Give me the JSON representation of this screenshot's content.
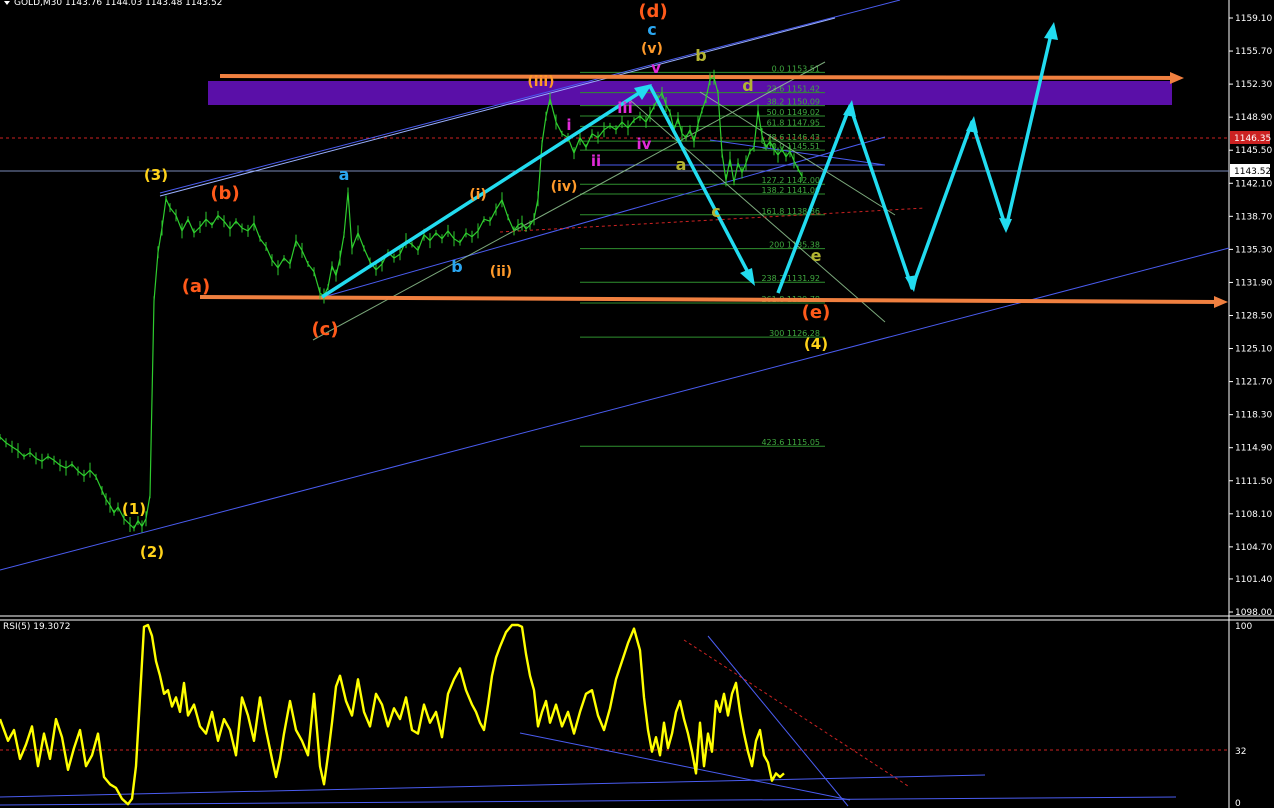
{
  "window": {
    "symbol_header": "GOLD,M30  1143.76 1144.03 1143.48 1143.52",
    "rsi_header": "RSI(5) 19.3072"
  },
  "price_axis": {
    "min": 1096.5,
    "max": 1161.5,
    "ticks": [
      "1159.10",
      "1155.70",
      "1152.30",
      "1148.90",
      "1145.50",
      "1142.10",
      "1138.70",
      "1135.30",
      "1131.90",
      "1128.50",
      "1125.10",
      "1121.70",
      "1118.30",
      "1114.90",
      "1111.50",
      "1108.10",
      "1104.70",
      "1101.40",
      "1098.00"
    ],
    "current_price": "1143.52",
    "marker_price": "1146.35",
    "current_price_color": "#ffffff",
    "marker_price_color": "#cc2222"
  },
  "rsi_axis": {
    "ticks": [
      "100",
      "32",
      "0"
    ]
  },
  "chart_data": [
    {
      "type": "line",
      "name": "price",
      "series_color": "#2ecc2e",
      "y_unit": "price",
      "x": [
        0,
        6,
        12,
        18,
        24,
        30,
        36,
        42,
        48,
        54,
        60,
        66,
        72,
        78,
        84,
        90,
        96,
        102,
        106,
        110,
        114,
        118,
        124,
        130,
        134,
        138,
        142,
        146,
        150,
        154,
        158,
        162,
        166,
        170,
        176,
        182,
        188,
        194,
        200,
        206,
        212,
        218,
        224,
        230,
        236,
        242,
        248,
        254,
        260,
        266,
        272,
        278,
        284,
        290,
        296,
        302,
        308,
        314,
        320,
        324,
        328,
        332,
        336,
        340,
        344,
        348,
        352,
        358,
        364,
        370,
        376,
        382,
        388,
        394,
        400,
        406,
        412,
        418,
        424,
        430,
        436,
        442,
        448,
        454,
        460,
        466,
        472,
        478,
        484,
        490,
        496,
        502,
        508,
        514,
        518,
        522,
        526,
        530,
        534,
        538,
        542,
        546,
        550,
        556,
        562,
        568,
        574,
        580,
        586,
        592,
        598,
        604,
        610,
        616,
        622,
        628,
        634,
        640,
        646,
        650,
        654,
        658,
        662,
        666,
        670,
        674,
        678,
        682,
        686,
        690,
        694,
        698,
        702,
        706,
        710,
        714,
        718,
        722,
        726,
        730,
        734,
        738,
        742,
        746,
        750,
        754,
        758,
        762,
        766,
        770,
        774,
        778,
        782,
        786,
        790,
        794,
        798,
        802
      ],
      "y": [
        1116.0,
        1115.4,
        1115.0,
        1114.6,
        1114.0,
        1114.4,
        1113.8,
        1113.5,
        1114.0,
        1113.6,
        1113.1,
        1112.8,
        1113.2,
        1112.5,
        1112.0,
        1112.6,
        1111.9,
        1110.5,
        1109.6,
        1109.0,
        1108.2,
        1108.8,
        1107.6,
        1107.0,
        1106.6,
        1107.4,
        1106.8,
        1107.6,
        1110.0,
        1130.0,
        1135.0,
        1137.5,
        1140.5,
        1139.6,
        1138.8,
        1137.2,
        1138.4,
        1137.0,
        1137.6,
        1138.4,
        1137.8,
        1138.8,
        1138.2,
        1137.4,
        1138.2,
        1137.5,
        1137.2,
        1138.0,
        1136.4,
        1135.6,
        1134.2,
        1133.4,
        1134.4,
        1133.8,
        1136.2,
        1135.2,
        1133.8,
        1133.0,
        1130.8,
        1130.5,
        1131.4,
        1133.6,
        1132.6,
        1134.4,
        1136.8,
        1141.2,
        1135.4,
        1137.0,
        1135.4,
        1134.0,
        1133.2,
        1133.8,
        1135.0,
        1134.4,
        1134.8,
        1136.2,
        1135.8,
        1135.2,
        1136.8,
        1136.2,
        1137.0,
        1136.4,
        1137.2,
        1136.4,
        1136.0,
        1137.0,
        1136.6,
        1137.2,
        1138.4,
        1138.2,
        1139.4,
        1140.4,
        1138.6,
        1137.2,
        1137.8,
        1138.0,
        1137.4,
        1137.8,
        1138.4,
        1140.5,
        1146.2,
        1149.0,
        1150.8,
        1148.4,
        1147.2,
        1146.8,
        1145.2,
        1146.8,
        1145.8,
        1147.2,
        1146.8,
        1147.6,
        1148.0,
        1147.6,
        1148.4,
        1147.8,
        1148.6,
        1149.0,
        1148.4,
        1149.2,
        1150.0,
        1150.8,
        1151.4,
        1150.2,
        1149.4,
        1147.6,
        1148.8,
        1147.2,
        1146.8,
        1147.6,
        1146.4,
        1148.2,
        1149.6,
        1150.8,
        1152.8,
        1153.0,
        1151.4,
        1145.2,
        1142.4,
        1144.6,
        1142.2,
        1144.2,
        1143.2,
        1144.2,
        1145.4,
        1145.8,
        1149.6,
        1147.0,
        1145.8,
        1146.4,
        1145.6,
        1145.0,
        1145.6,
        1144.8,
        1145.4,
        1144.4,
        1143.6,
        1142.8,
        1143.5
      ]
    },
    {
      "type": "line",
      "name": "RSI(5)",
      "series_color": "#ffff00",
      "y_unit": "rsi",
      "ylim": [
        0,
        100
      ],
      "levels": [
        32
      ],
      "x": [
        0,
        8,
        14,
        20,
        26,
        32,
        38,
        44,
        50,
        56,
        62,
        68,
        74,
        80,
        86,
        92,
        98,
        104,
        110,
        116,
        122,
        128,
        132,
        136,
        140,
        144,
        148,
        152,
        156,
        160,
        164,
        168,
        172,
        176,
        180,
        184,
        188,
        194,
        200,
        206,
        212,
        218,
        224,
        230,
        236,
        242,
        248,
        254,
        260,
        266,
        272,
        276,
        280,
        284,
        290,
        296,
        302,
        308,
        314,
        320,
        324,
        328,
        332,
        336,
        340,
        346,
        352,
        358,
        364,
        370,
        376,
        382,
        388,
        394,
        400,
        406,
        412,
        418,
        424,
        430,
        436,
        442,
        448,
        454,
        460,
        466,
        472,
        476,
        480,
        484,
        488,
        492,
        496,
        500,
        506,
        512,
        518,
        522,
        526,
        530,
        534,
        538,
        542,
        546,
        550,
        556,
        562,
        568,
        574,
        580,
        586,
        592,
        598,
        604,
        610,
        616,
        622,
        628,
        634,
        640,
        644,
        648,
        652,
        656,
        660,
        664,
        668,
        672,
        676,
        680,
        684,
        688,
        692,
        696,
        700,
        704,
        708,
        712,
        716,
        720,
        724,
        728,
        732,
        736,
        740,
        744,
        748,
        752,
        756,
        760,
        764,
        768,
        772,
        776,
        780,
        784,
        788,
        792,
        796,
        800,
        804
      ],
      "y": [
        48,
        36,
        42,
        26,
        34,
        44,
        22,
        40,
        26,
        48,
        38,
        20,
        32,
        42,
        22,
        28,
        40,
        16,
        12,
        10,
        4,
        1,
        4,
        22,
        60,
        99,
        100,
        94,
        80,
        72,
        62,
        64,
        55,
        60,
        52,
        68,
        50,
        56,
        44,
        40,
        52,
        36,
        48,
        42,
        28,
        60,
        50,
        36,
        60,
        42,
        26,
        16,
        26,
        40,
        58,
        42,
        36,
        28,
        62,
        22,
        12,
        28,
        46,
        66,
        72,
        58,
        50,
        70,
        52,
        44,
        62,
        56,
        44,
        54,
        48,
        60,
        42,
        40,
        56,
        46,
        52,
        38,
        62,
        70,
        76,
        64,
        56,
        52,
        46,
        42,
        56,
        72,
        82,
        88,
        96,
        100,
        100,
        99,
        84,
        72,
        64,
        44,
        52,
        58,
        46,
        56,
        44,
        52,
        40,
        52,
        62,
        64,
        50,
        42,
        54,
        70,
        80,
        90,
        98,
        86,
        60,
        42,
        30,
        38,
        28,
        46,
        32,
        40,
        52,
        58,
        48,
        40,
        30,
        18,
        46,
        22,
        40,
        30,
        58,
        52,
        62,
        50,
        62,
        68,
        52,
        40,
        30,
        22,
        36,
        42,
        28,
        24,
        14,
        18,
        16,
        18
      ]
    }
  ],
  "fibo": [
    {
      "label": "0.0 1153.51"
    },
    {
      "label": "23.6 1151.42"
    },
    {
      "label": "38.2 1150.09"
    },
    {
      "label": "50.0 1149.02"
    },
    {
      "label": "61.8 1147.95"
    },
    {
      "label": "78.6 1146.43"
    },
    {
      "label": "100.0 1145.51"
    },
    {
      "label": "127.2 1142.00"
    },
    {
      "label": "138.2 1141.00"
    },
    {
      "label": "161.8 1138.86"
    },
    {
      "label": "200 1135.38"
    },
    {
      "label": "238.2 1131.92"
    },
    {
      "label": "261.8 1129.78"
    },
    {
      "label": "300 1126.28"
    },
    {
      "label": "423.6 1115.05"
    }
  ],
  "wave_labels": {
    "w1": "(1)",
    "w2": "(2)",
    "w3": "(3)",
    "w4": "(4)",
    "wa_big": "(a)",
    "wb_big": "(b)",
    "wc_big": "(c)",
    "wd_big": "(d)",
    "we_big": "(e)",
    "a1": "a",
    "b1": "b",
    "c1": "c",
    "a2": "a",
    "b2": "b",
    "c2": "c",
    "d2": "d",
    "e2": "e",
    "ri": "(i)",
    "rii": "(ii)",
    "riii": "(iii)",
    "riv": "(iv)",
    "rv": "(v)",
    "si": "i",
    "sii": "ii",
    "siii": "iii",
    "siv": "iv",
    "sv": "v"
  },
  "colors": {
    "background": "#000000",
    "axis": "#ffffff",
    "trendline": "#4a5cf0",
    "projection_arrow": "#22dcf0",
    "resistance_line": "#f08040",
    "supply_zone": "#5a0fa8",
    "rsi_line": "#ffff00",
    "dotted_level": "#cc2222",
    "fibo": "#2f8f2f",
    "wave_red": "#ff5a1a",
    "wave_yellow": "#ffd21a",
    "wave_blue": "#2aa6f0",
    "wave_orange": "#ff9a2a",
    "wave_magenta": "#e02ad8",
    "wave_olive": "#b4b432"
  }
}
